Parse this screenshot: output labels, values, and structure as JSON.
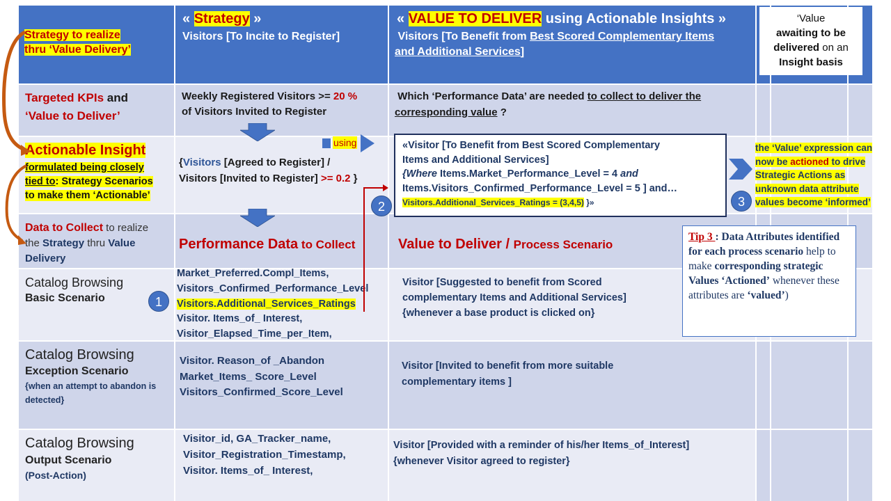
{
  "header": {
    "left_label_line1": "Strategy to realize",
    "left_label_line2": "thru ‘Value Delivery’",
    "strategy_open": "« ",
    "strategy_word": "Strategy",
    "strategy_close": " »",
    "strategy_sub": "Visitors [To Incite to Register]",
    "value_open": "« ",
    "value_word": "VALUE TO DELIVER",
    "value_rest": " using Actionable Insights »",
    "value_sub_plain": "Visitors [To Benefit from ",
    "value_sub_underlined_1": "Best Scored Complementary Items",
    "value_sub_underlined_2": "and Additional Services",
    "value_sub_close": "]",
    "awaiting_line1": "‘Value",
    "awaiting_line2": "awaiting to be",
    "awaiting_line3_bold": "delivered",
    "awaiting_line3_rest": " on an",
    "awaiting_line4": "Insight basis"
  },
  "row_kpi": {
    "label_red": "Targeted KPIs",
    "label_and": " and",
    "label_line2": "‘Value to Deliver’",
    "strategy_text_1": "Weekly Registered Visitors >= ",
    "strategy_pct": "20 %",
    "strategy_text_2": "of Visitors Invited to Register",
    "value_text_plain": "Which ‘Performance Data’ are needed ",
    "value_text_u1": "to collect to deliver  the",
    "value_text_u2": "corresponding value",
    "value_text_end": " ?"
  },
  "row_insight": {
    "label_title": "Actionable Insight",
    "label_u": "formulated being closely",
    "label_u2": "tied to",
    "label_rest": ": Strategy Scenarios",
    "label_line4": "to make them ‘Actionable’",
    "formula_open": "{",
    "formula_visitors": "Visitors",
    "formula_1": " [Agreed to Register] /",
    "formula_2": "Visitors [Invited to Register] ",
    "formula_threshold": ">= 0.2",
    "formula_close": " }",
    "using_label": "using",
    "insight_box_line1": "«Visitor [To Benefit from Best Scored Complementary",
    "insight_box_line2": "Items and Additional Services]",
    "insight_box_line3_where": "{Where",
    "insight_box_line3_rest": " Items.Market_Performance_Level = 4 ",
    "insight_box_line3_and": "and",
    "insight_box_line4": "Items.Visitors_Confirmed_Performance_Level  = 5 ] and…",
    "insight_box_line5_hl": "Visitors.Additional_Services_Ratings  = (3,4,5)",
    "insight_box_line5_end": " }»",
    "actioned_1": "the ‘Value’ expression can",
    "actioned_2a": "now be ",
    "actioned_2b": "actioned",
    "actioned_2c": " to drive",
    "actioned_3": "Strategic Actions as",
    "actioned_4": "unknown data attribute",
    "actioned_5": "values become ‘informed’"
  },
  "row_collect": {
    "label_red": "Data to Collect",
    "label_rest": " to realize",
    "label_the": "the ",
    "label_strategy": "Strategy",
    "label_thru": " thru ",
    "label_value": "Value",
    "label_delivery": "Delivery",
    "perf_big": "Performance Data",
    "perf_small": " to Collect",
    "value_big": "Value to Deliver / ",
    "value_small": "Process Scenario"
  },
  "tip": {
    "title": "Tip 3 ",
    "colon": ": ",
    "bold1": "Data Attributes identified for each process scenario",
    "plain1": " help to make ",
    "bold2": "corresponding strategic Values ‘Actioned’",
    "plain2": " whenever these attributes are ",
    "bold3": "‘valued’",
    "end": ")"
  },
  "scenarios": [
    {
      "name": "Catalog Browsing",
      "type": "Basic Scenario",
      "note": "",
      "data": [
        "Market_Preferred.Compl_Items,",
        "Visitors_Confirmed_Performance_Level",
        "Visitors.Additional_Services_Ratings",
        "Visitor. Items_of_ Interest,",
        "Visitor_Elapsed_Time_per_Item,"
      ],
      "value_lines": [
        "Visitor [Suggested to benefit from Scored",
        "complementary Items and Additional Services]",
        "{whenever a base product is clicked on}"
      ]
    },
    {
      "name": "Catalog Browsing",
      "type": "Exception Scenario",
      "note": "{when an attempt to abandon is detected}",
      "data": [
        "Visitor. Reason_of _Abandon",
        "Market_Items_ Score_Level",
        "Visitors_Confirmed_Score_Level"
      ],
      "value_lines": [
        "Visitor [Invited to benefit from more suitable",
        "complementary items ]"
      ]
    },
    {
      "name": "Catalog Browsing",
      "type": "Output Scenario",
      "note": "(Post-Action)",
      "data": [
        "Visitor_id, GA_Tracker_name,",
        "Visitor_Registration_Timestamp,",
        "Visitor. Items_of_ Interest,"
      ],
      "value_lines": [
        "Visitor [Provided with a reminder of his/her Items_of_Interest]",
        "{whenever Visitor agreed to register}"
      ]
    }
  ],
  "badges": [
    "1",
    "2",
    "3"
  ],
  "colors": {
    "header_blue": "#4472c4",
    "row_dark": "#cfd5ea",
    "row_light": "#e9ebf5",
    "accent_red": "#c00000",
    "navy_text": "#1f3864",
    "highlight": "#ffff00",
    "curve_arrow": "#c55a11"
  }
}
